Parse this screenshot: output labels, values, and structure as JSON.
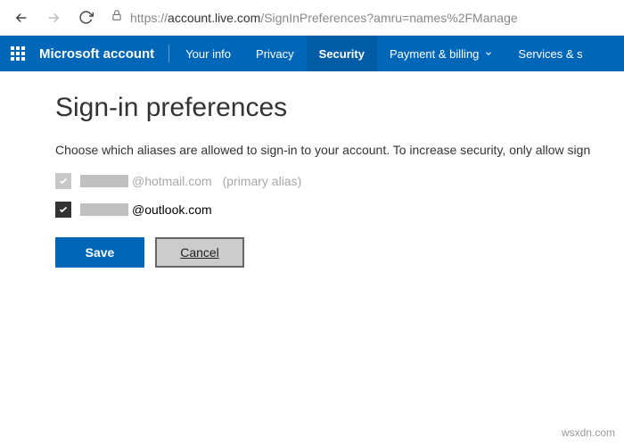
{
  "browser": {
    "url_proto": "https://",
    "url_host": "account.live.com",
    "url_path": "/SignInPreferences?amru=names%2FManage"
  },
  "nav": {
    "brand": "Microsoft account",
    "items": [
      {
        "label": "Your info",
        "active": false
      },
      {
        "label": "Privacy",
        "active": false
      },
      {
        "label": "Security",
        "active": true
      },
      {
        "label": "Payment & billing",
        "active": false,
        "dropdown": true
      },
      {
        "label": "Services & s",
        "active": false
      }
    ]
  },
  "page": {
    "title": "Sign-in preferences",
    "subtitle": "Choose which aliases are allowed to sign-in to your account. To increase security, only allow sign",
    "aliases": [
      {
        "domain_suffix": "@hotmail.com",
        "primary_label": "(primary alias)",
        "disabled": true
      },
      {
        "domain_suffix": "@outlook.com",
        "disabled": false
      }
    ],
    "save_label": "Save",
    "cancel_label": "Cancel"
  },
  "watermark": "wsxdn.com"
}
